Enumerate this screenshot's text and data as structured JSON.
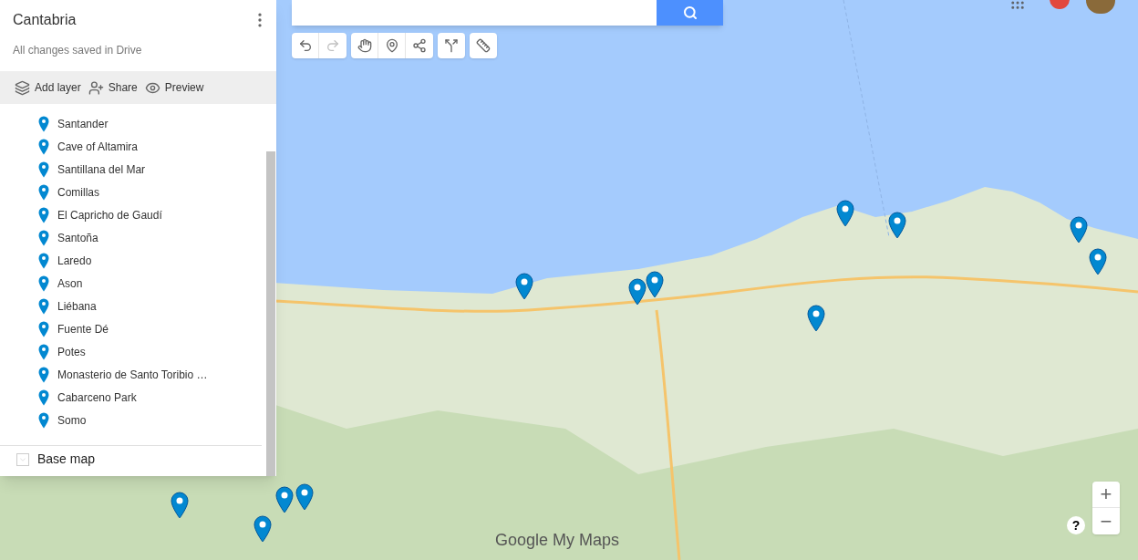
{
  "map_title": "Cantabria",
  "save_status": "All changes saved in Drive",
  "actions": [
    {
      "kind": "layer",
      "label": "Add layer"
    },
    {
      "kind": "share",
      "label": "Share"
    },
    {
      "kind": "preview",
      "label": "Preview"
    }
  ],
  "places": [
    {
      "label": "Santander"
    },
    {
      "label": "Cave of Altamira"
    },
    {
      "label": "Santillana del Mar"
    },
    {
      "label": "Comillas"
    },
    {
      "label": "El Capricho de Gaudí"
    },
    {
      "label": "Santoña"
    },
    {
      "label": "Laredo"
    },
    {
      "label": "Ason"
    },
    {
      "label": "Liébana"
    },
    {
      "label": "Fuente Dé"
    },
    {
      "label": "Potes"
    },
    {
      "label": "Monasterio de Santo Toribio …"
    },
    {
      "label": "Cabarceno Park"
    },
    {
      "label": "Somo"
    }
  ],
  "base_map": {
    "label": "Base map",
    "expanded": false
  },
  "map_controls": {
    "zoom_in": "+",
    "zoom_out": "−",
    "help": "?"
  },
  "map_logo": "Google My Maps"
}
